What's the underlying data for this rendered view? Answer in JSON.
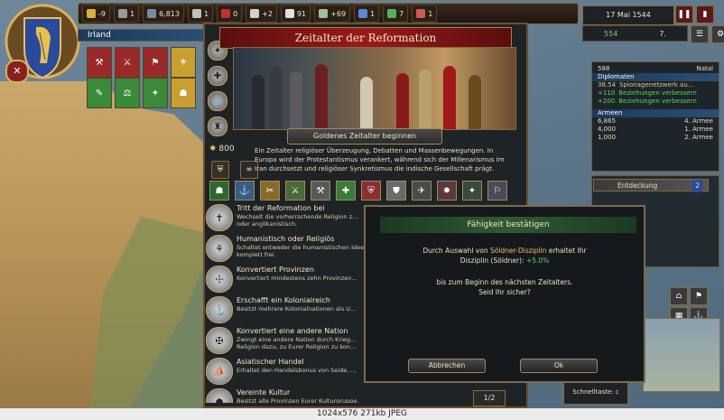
{
  "country": {
    "name": "Irland"
  },
  "topbar": {
    "resources": [
      {
        "name": "treasury",
        "value": "-9",
        "color": "#d8b040"
      },
      {
        "name": "manpower",
        "value": "1",
        "color": "#9a9a9a"
      },
      {
        "name": "sailors",
        "value": "6,813",
        "color": "#7a8aa0"
      },
      {
        "name": "stability",
        "value": "1",
        "color": "#c0c0c0"
      },
      {
        "name": "corruption",
        "value": "0",
        "color": "#c03030"
      },
      {
        "name": "prestige",
        "value": "+2",
        "color": "#d0d0d0"
      },
      {
        "name": "legitimacy",
        "value": "91",
        "color": "#e0e0e0"
      },
      {
        "name": "power",
        "value": "+69",
        "color": "#a0c0a0"
      },
      {
        "name": "admin",
        "value": "1",
        "color": "#5a8ad0"
      },
      {
        "name": "diplo",
        "value": "7",
        "color": "#5ab05a"
      },
      {
        "name": "military",
        "value": "1",
        "color": "#d05a5a"
      }
    ]
  },
  "date": {
    "label": "17 Mai 1544"
  },
  "quickstats": {
    "a": "554",
    "b": "7."
  },
  "panel": {
    "title": "Zeitalter der Reformation",
    "golden_button": "Goldenes Zeitalter beginnen",
    "score": "800",
    "description": "Ein Zeitalter religiöser Überzeugung, Debatten und Massenbewegungen. In Europa wird der Protestantismus verankert, während sich der Millenarismus im Iran durchsetzt und religiöser Synkretismus die indische Gesellschaft prägt.",
    "objectives": [
      {
        "title": "Tritt der Reformation bei",
        "desc": "Wechselt die vorherrschende Religion z… oder anglikanistisch."
      },
      {
        "title": "Humanistisch oder Religiös",
        "desc": "Schaltet entweder die humanistischen Ideen komplett frei."
      },
      {
        "title": "Konvertiert Provinzen",
        "desc": "Konvertiert mindestens zehn Provinzen…"
      },
      {
        "title": "Erschafft ein Kolonialreich",
        "desc": "Besitzt mehrere Kolonialnationen als U…"
      },
      {
        "title": "Konvertiert eine andere Nation",
        "desc": "Zwingt eine andere Nation durch Krieg… Religion dazu, zu Eurer Religion zu kon…"
      },
      {
        "title": "Asiatischer Handel",
        "desc": "Erhaltet den Handelsbonus von Seide, …"
      },
      {
        "title": "Vereinte Kultur",
        "desc": "Besitzt alle Provinzen Eurer Kulturgruppe."
      }
    ],
    "pager": "1/2"
  },
  "dialog": {
    "title": "Fähigkeit bestätigen",
    "line1_pre": "Durch Auswahl von ",
    "line1_hl": "Söldner-Disziplin",
    "line1_post": " erhaltet Ihr",
    "line2_pre": "Disziplin (Söldner): ",
    "line2_val": "+5.0%",
    "line3": "bis zum Beginn des nächsten Zeitalters.",
    "line4": "Seid Ihr sicher?",
    "cancel": "Abbrechen",
    "ok": "Ok"
  },
  "rightpanel": {
    "top_value": "588",
    "top_label": "Natal",
    "diplomats_header": "Diplomaten",
    "diplomats": [
      {
        "value": "38.54",
        "text": "Spionagenetzwerk au…"
      },
      {
        "value": "+110",
        "text": "Beziehungen verbessern"
      },
      {
        "value": "+200",
        "text": "Beziehungen verbessern"
      }
    ],
    "armies_header": "Armeen",
    "armies": [
      {
        "count": "6,865",
        "name": "4. Armee"
      },
      {
        "count": "4,000",
        "name": "1. Armee"
      },
      {
        "count": "1,000",
        "name": "2. Armee"
      }
    ],
    "discovery": "Entdeckung",
    "discovery_badge": "2"
  },
  "quickbar": {
    "label": "Schnelltaste: c"
  },
  "caption": "1024x576  271kb  JPEG"
}
